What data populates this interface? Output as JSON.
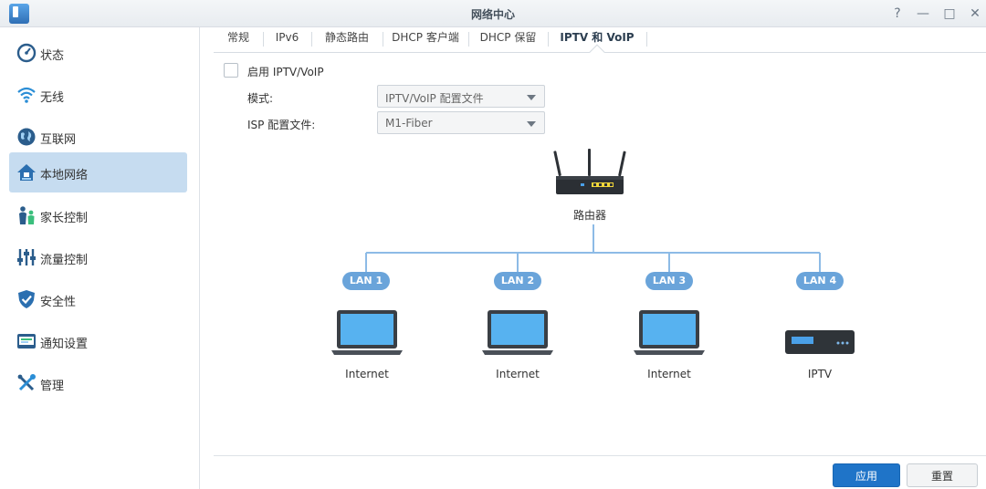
{
  "window": {
    "title": "网络中心",
    "controls": [
      "?",
      "—",
      "□",
      "✕"
    ]
  },
  "sidebar": {
    "items": [
      {
        "label": "状态",
        "icon": "status-gauge-icon"
      },
      {
        "label": "无线",
        "icon": "wifi-icon"
      },
      {
        "label": "互联网",
        "icon": "globe-icon"
      },
      {
        "label": "本地网络",
        "icon": "home-network-icon",
        "active": true
      },
      {
        "label": "家长控制",
        "icon": "family-icon"
      },
      {
        "label": "流量控制",
        "icon": "sliders-icon"
      },
      {
        "label": "安全性",
        "icon": "shield-icon"
      },
      {
        "label": "通知设置",
        "icon": "notification-icon"
      },
      {
        "label": "管理",
        "icon": "tools-icon"
      }
    ]
  },
  "tabs": [
    {
      "label": "常规"
    },
    {
      "label": "IPv6"
    },
    {
      "label": "静态路由"
    },
    {
      "label": "DHCP 客户端"
    },
    {
      "label": "DHCP 保留"
    },
    {
      "label": "IPTV 和 VoIP",
      "active": true
    }
  ],
  "form": {
    "enable_label": "启用 IPTV/VoIP",
    "enable_checked": false,
    "mode_label": "模式:",
    "mode_value": "IPTV/VoIP 配置文件",
    "isp_label": "ISP 配置文件:",
    "isp_value": "M1-Fiber"
  },
  "diagram": {
    "router_label": "路由器",
    "ports": [
      {
        "badge": "LAN 1",
        "device": "laptop",
        "label": "Internet"
      },
      {
        "badge": "LAN 2",
        "device": "laptop",
        "label": "Internet"
      },
      {
        "badge": "LAN 3",
        "device": "laptop",
        "label": "Internet"
      },
      {
        "badge": "LAN 4",
        "device": "settop-box",
        "label": "IPTV"
      }
    ],
    "line_color": "#8dbbe6"
  },
  "footer": {
    "apply_label": "应用",
    "reset_label": "重置"
  },
  "colors": {
    "accent": "#1f74c8",
    "sidebar_active": "#c6dcf0",
    "badge": "#6aa4da",
    "screen": "#57b2f0"
  }
}
